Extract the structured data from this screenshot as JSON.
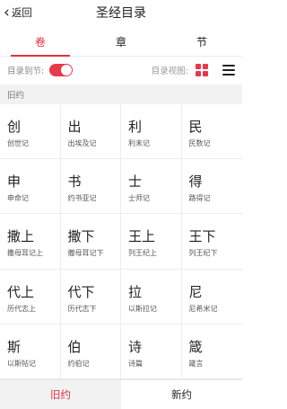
{
  "header": {
    "back_icon": "chevron-left-icon",
    "back_label": "返回",
    "title": "圣经目录"
  },
  "tabs": [
    {
      "label": "卷",
      "active": true
    },
    {
      "label": "章",
      "active": false
    },
    {
      "label": "节",
      "active": false
    }
  ],
  "options": {
    "to_verse_label": "目录到节:",
    "to_verse_enabled": true,
    "view_label": "目录视图:",
    "grid_view_icon": "grid-view-icon",
    "list_view_icon": "list-view-icon"
  },
  "section_title": "旧约",
  "books": [
    {
      "abbr": "创",
      "name": "创世记"
    },
    {
      "abbr": "出",
      "name": "出埃及记"
    },
    {
      "abbr": "利",
      "name": "利未记"
    },
    {
      "abbr": "民",
      "name": "民数记"
    },
    {
      "abbr": "申",
      "name": "申命记"
    },
    {
      "abbr": "书",
      "name": "约书亚记"
    },
    {
      "abbr": "士",
      "name": "士师记"
    },
    {
      "abbr": "得",
      "name": "路得记"
    },
    {
      "abbr": "撒上",
      "name": "撒母耳记上"
    },
    {
      "abbr": "撒下",
      "name": "撒母耳记下"
    },
    {
      "abbr": "王上",
      "name": "列王纪上"
    },
    {
      "abbr": "王下",
      "name": "列王纪下"
    },
    {
      "abbr": "代上",
      "name": "历代志上"
    },
    {
      "abbr": "代下",
      "name": "历代志下"
    },
    {
      "abbr": "拉",
      "name": "以斯拉记"
    },
    {
      "abbr": "尼",
      "name": "尼希米记"
    },
    {
      "abbr": "斯",
      "name": "以斯帖记"
    },
    {
      "abbr": "伯",
      "name": "约伯记"
    },
    {
      "abbr": "诗",
      "name": "诗篇"
    },
    {
      "abbr": "箴",
      "name": "箴言"
    }
  ],
  "bottom_tabs": [
    {
      "label": "旧约",
      "active": true
    },
    {
      "label": "新约",
      "active": false
    }
  ],
  "colors": {
    "accent": "#e0303f",
    "section_bg": "#f2f2f2"
  }
}
